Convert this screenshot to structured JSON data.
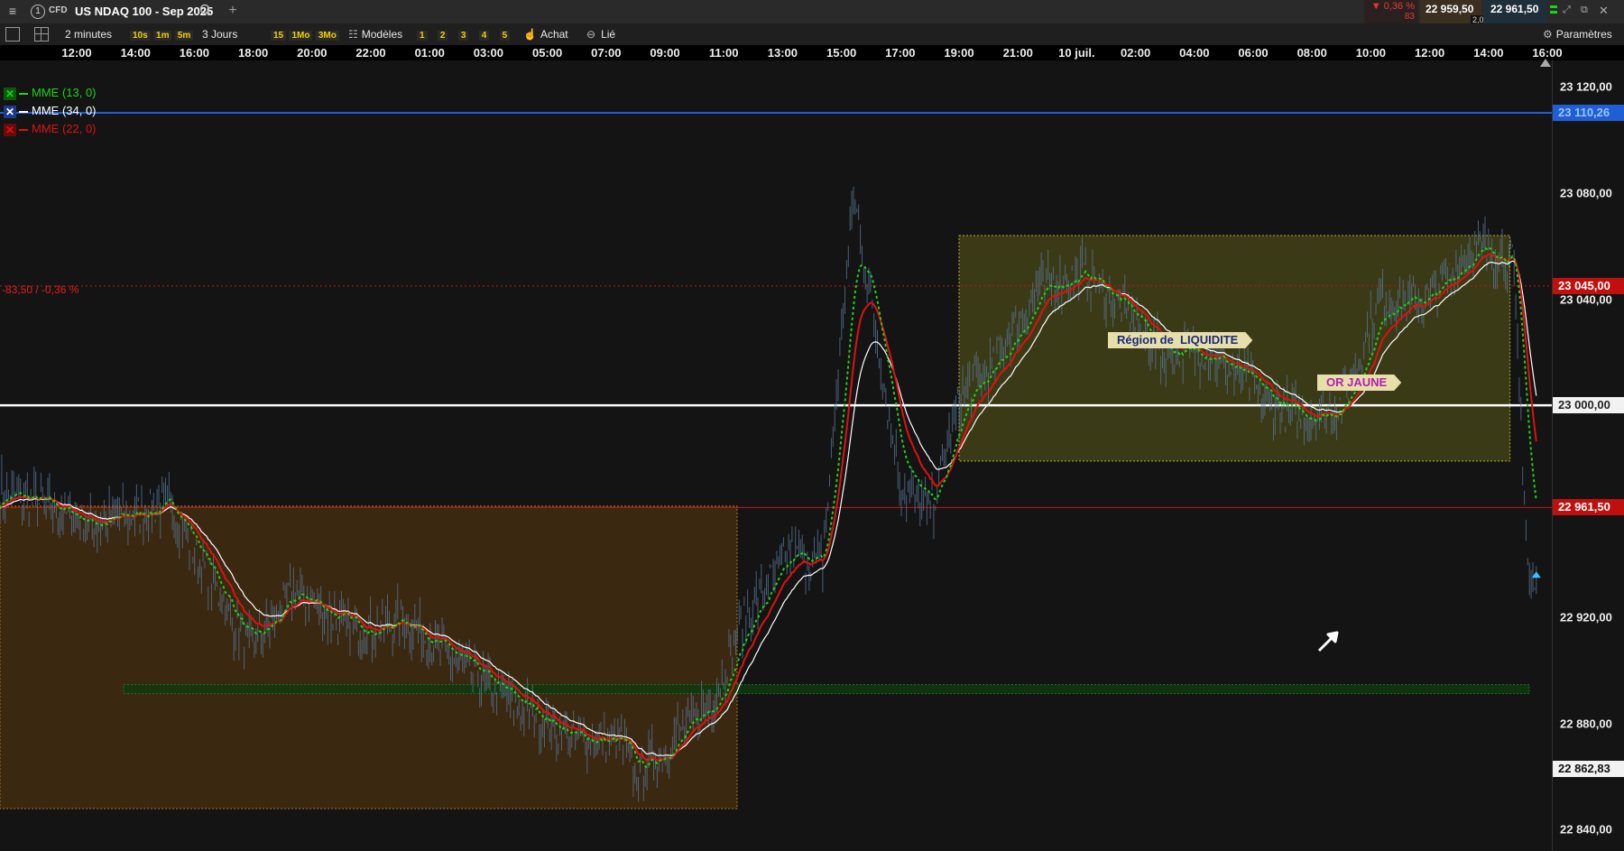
{
  "window": {
    "menu_icon": "hamburger-icon",
    "tab_number": "1",
    "instrument_type": "CFD",
    "instrument_name": "US NDAQ 100 - Sep 2025",
    "change_pct": "▼ 0,36 %",
    "change_pts": "83",
    "bid": "22 959,50",
    "spread": "2,00",
    "ask": "22 961,50"
  },
  "toolbar": {
    "timeframe": "2 minutes",
    "quick_intervals": [
      "10s",
      "1m",
      "5m"
    ],
    "period": "3 Jours",
    "quick_periods": [
      "15",
      "1Mo",
      "3Mo"
    ],
    "models_label": "Modèles",
    "slots": [
      "1",
      "2",
      "3",
      "4",
      "5"
    ],
    "buy_label": "Achat",
    "linked_label": "Lié",
    "settings_label": "Paramètres"
  },
  "time_axis": [
    "12:00",
    "14:00",
    "16:00",
    "18:00",
    "20:00",
    "22:00",
    "01:00",
    "03:00",
    "05:00",
    "07:00",
    "09:00",
    "11:00",
    "13:00",
    "15:00",
    "17:00",
    "19:00",
    "21:00",
    "10 juil.",
    "02:00",
    "04:00",
    "06:00",
    "08:00",
    "10:00",
    "12:00",
    "14:00",
    "16:00"
  ],
  "legend": [
    {
      "label": "MME (13, 0)",
      "color": "#19d419",
      "box": "#0a5a0a"
    },
    {
      "label": "MME (34, 0)",
      "color": "#ffffff",
      "box": "#1a3a8a"
    },
    {
      "label": "MME (22, 0)",
      "color": "#e01010",
      "box": "#6a0a0a"
    }
  ],
  "change_line_label": "-83,50 / -0,36 %",
  "annotations": {
    "liquidity": "Région de  LIQUIDITE",
    "gold": "OR JAUNE"
  },
  "y_axis": {
    "ticks": [
      "23 120,00",
      "23 080,00",
      "23 040,00",
      "23 000,00",
      "22 920,00",
      "22 880,00",
      "22 840,00"
    ],
    "tags": {
      "blue_line": "23 110,26",
      "ref_line": "23 045,00",
      "white_line": "23 000,00",
      "last_price": "22 961,50",
      "low_marker": "22 862,83"
    }
  },
  "colors": {
    "background": "#141414",
    "blue_line": "#1f5fd6",
    "red_line": "#c01818",
    "white_line": "#ffffff",
    "price_tag": "#c0100e",
    "box_orange": "#4a3110",
    "box_olive": "#4a4a18"
  },
  "chart_data": {
    "type": "line",
    "title": "US NDAQ 100 - Sep 2025",
    "xlabel": "",
    "ylabel": "",
    "x_ticks": [
      "12:00",
      "14:00",
      "16:00",
      "18:00",
      "20:00",
      "22:00",
      "01:00",
      "03:00",
      "05:00",
      "07:00",
      "09:00",
      "11:00",
      "13:00",
      "15:00",
      "17:00",
      "19:00",
      "21:00",
      "10 juil.",
      "02:00",
      "04:00",
      "06:00",
      "08:00",
      "10:00",
      "12:00",
      "14:00",
      "16:00"
    ],
    "ylim": [
      22832,
      23130
    ],
    "grid": false,
    "legend_position": "top-left",
    "series": [
      {
        "name": "MME (13, 0)",
        "color": "#19d419"
      },
      {
        "name": "MME (34, 0)",
        "color": "#ffffff"
      },
      {
        "name": "MME (22, 0)",
        "color": "#e01010"
      }
    ],
    "price_keypoints": [
      [
        0,
        22968
      ],
      [
        0.03,
        22962
      ],
      [
        0.06,
        22955
      ],
      [
        0.09,
        22960
      ],
      [
        0.11,
        22963
      ],
      [
        0.13,
        22940
      ],
      [
        0.16,
        22908
      ],
      [
        0.19,
        22930
      ],
      [
        0.22,
        22918
      ],
      [
        0.24,
        22915
      ],
      [
        0.26,
        22920
      ],
      [
        0.29,
        22905
      ],
      [
        0.32,
        22892
      ],
      [
        0.34,
        22885
      ],
      [
        0.37,
        22874
      ],
      [
        0.4,
        22873
      ],
      [
        0.41,
        22860
      ],
      [
        0.43,
        22872
      ],
      [
        0.46,
        22890
      ],
      [
        0.48,
        22920
      ],
      [
        0.51,
        22945
      ],
      [
        0.53,
        22940
      ],
      [
        0.55,
        23080
      ],
      [
        0.565,
        23025
      ],
      [
        0.58,
        22970
      ],
      [
        0.6,
        22960
      ],
      [
        0.62,
        23005
      ],
      [
        0.64,
        23015
      ],
      [
        0.67,
        23045
      ],
      [
        0.7,
        23050
      ],
      [
        0.75,
        23020
      ],
      [
        0.78,
        23020
      ],
      [
        0.82,
        23000
      ],
      [
        0.84,
        22995
      ],
      [
        0.865,
        23000
      ],
      [
        0.89,
        23040
      ],
      [
        0.92,
        23040
      ],
      [
        0.95,
        23060
      ],
      [
        0.975,
        23055
      ],
      [
        0.985,
        22935
      ],
      [
        0.99,
        22930
      ]
    ],
    "horizontal_levels": {
      "blue": 23110.26,
      "reference": 23045.0,
      "round_number": 23000.0,
      "last_price": 22961.5,
      "support": 22893
    },
    "boxes": [
      {
        "from_x": 0.0,
        "to_x": 0.475,
        "y_top": 22962,
        "y_bottom": 22848
      },
      {
        "from_x": 0.618,
        "to_x": 0.973,
        "y_top": 23064,
        "y_bottom": 22979
      }
    ]
  }
}
